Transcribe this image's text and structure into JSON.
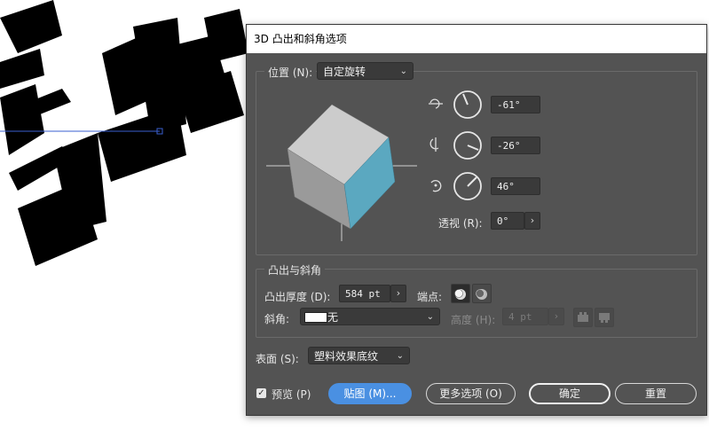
{
  "dialog": {
    "title": "3D 凸出和斜角选项"
  },
  "position": {
    "label": "位置 (N):",
    "preset": "自定旋转",
    "rot_x": "-61°",
    "rot_y": "-26°",
    "rot_z": "46°",
    "perspective_label": "透视 (R):",
    "perspective": "0°"
  },
  "extrude": {
    "group_title": "凸出与斜角",
    "depth_label": "凸出厚度 (D):",
    "depth": "584 pt",
    "cap_label": "端点:",
    "bevel_label": "斜角:",
    "bevel": "无",
    "height_label": "高度 (H):",
    "height": "4 pt"
  },
  "surface": {
    "label": "表面 (S):",
    "value": "塑料效果底纹"
  },
  "footer": {
    "preview_label": "预览 (P)",
    "preview_checked": "✓",
    "map_label": "贴图 (M)...",
    "more_label": "更多选项 (O)",
    "ok_label": "确定",
    "reset_label": "重置"
  },
  "stepper_glyph": "›",
  "caret_glyph": "⌄",
  "colors": {
    "dialog_bg": "#535353",
    "accent_blue": "#4a90e2",
    "cube_side": "#5ba8c0"
  },
  "icons": {
    "rot_x": "rotate-x-icon",
    "rot_y": "rotate-y-icon",
    "rot_z": "rotate-z-icon",
    "cap_on": "cap-on-icon",
    "cap_off": "cap-off-icon"
  }
}
